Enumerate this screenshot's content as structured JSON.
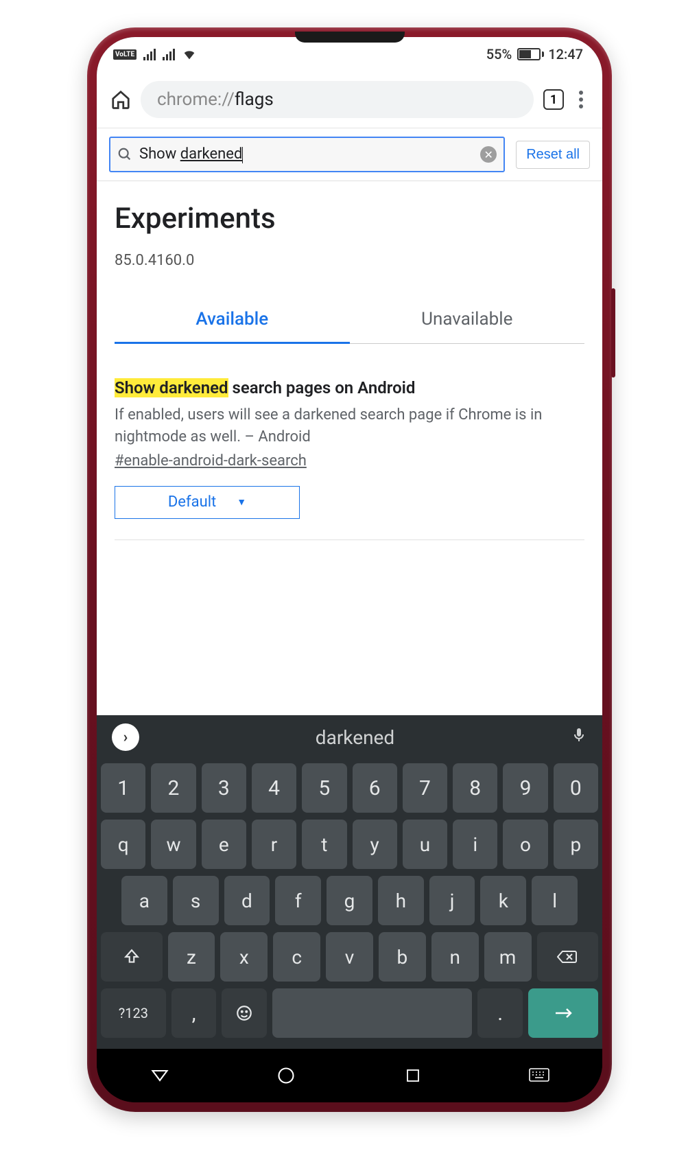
{
  "status": {
    "volte": "VoLTE",
    "battery_pct": "55%",
    "time": "12:47"
  },
  "browser": {
    "url_scheme": "chrome://",
    "url_path": "flags",
    "tab_count": "1"
  },
  "flags": {
    "search_prefix": "Show ",
    "search_underlined": "darkened",
    "reset_label": "Reset all",
    "title": "Experiments",
    "version": "85.0.4160.0",
    "tab_available": "Available",
    "tab_unavailable": "Unavailable",
    "result": {
      "title_highlight": "Show darkened",
      "title_rest": " search pages on Android",
      "description": "If enabled, users will see a darkened search page if Chrome is in nightmode as well. – Android",
      "id": "#enable-android-dark-search",
      "select_value": "Default"
    }
  },
  "keyboard": {
    "suggestion": "darkened",
    "row1": [
      "1",
      "2",
      "3",
      "4",
      "5",
      "6",
      "7",
      "8",
      "9",
      "0"
    ],
    "row2": [
      "q",
      "w",
      "e",
      "r",
      "t",
      "y",
      "u",
      "i",
      "o",
      "p"
    ],
    "row3": [
      "a",
      "s",
      "d",
      "f",
      "g",
      "h",
      "j",
      "k",
      "l"
    ],
    "row4": [
      "z",
      "x",
      "c",
      "v",
      "b",
      "n",
      "m"
    ],
    "sym_key": "?123",
    "period": ".",
    "comma": ","
  }
}
